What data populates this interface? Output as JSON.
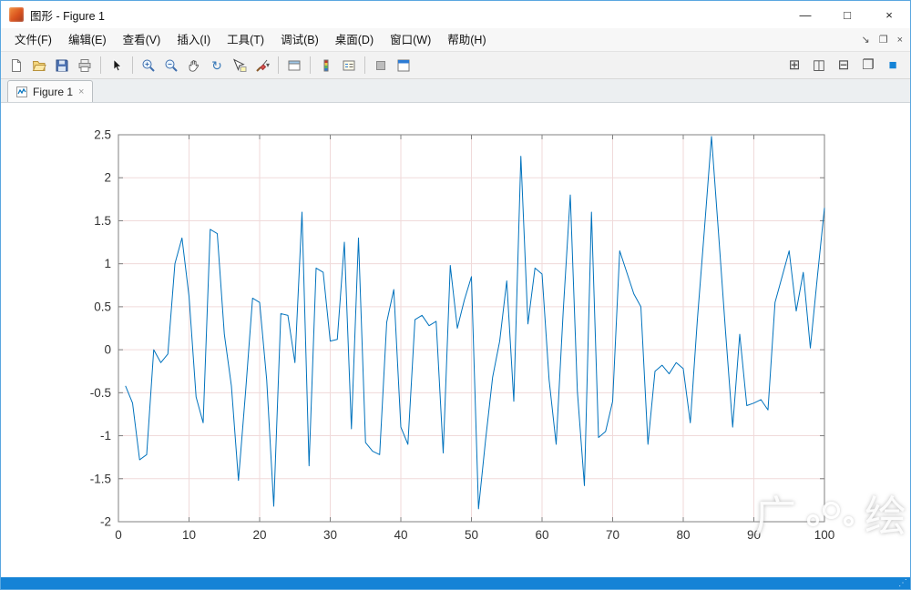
{
  "colors": {
    "accent": "#1583d6",
    "window_border": "#5aa7e0"
  },
  "window": {
    "title": "图形 - Figure 1",
    "controls": {
      "minimize": "—",
      "maximize": "□",
      "close": "×"
    }
  },
  "menubar": {
    "items": [
      "文件(F)",
      "编辑(E)",
      "查看(V)",
      "插入(I)",
      "工具(T)",
      "调试(B)",
      "桌面(D)",
      "窗口(W)",
      "帮助(H)"
    ],
    "right_icons": {
      "dock_arrow": "↘",
      "undock": "❐",
      "close": "×"
    }
  },
  "toolbar": {
    "icons": [
      "new-figure",
      "open-file",
      "save-figure",
      "print-figure",
      "edit-cursor",
      "zoom-in",
      "zoom-out",
      "pan",
      "rotate-3d",
      "data-cursor",
      "brush",
      "link-plots",
      "insert-colorbar",
      "insert-legend",
      "hide-plot-tools",
      "dock-figure"
    ],
    "right_icons": [
      "tile-windows",
      "split-vertical",
      "split-horizontal",
      "float-windows",
      "active-window"
    ],
    "rotate_glyph": "↻",
    "brush_dropdown": "▾",
    "layout_glyphs": {
      "tile": "⊞",
      "split_vertical": "◫",
      "split_horizontal": "⊟",
      "float": "❐",
      "active": "■"
    }
  },
  "tab": {
    "label": "Figure 1",
    "close": "×"
  },
  "chart_data": {
    "type": "line",
    "title": "",
    "xlabel": "",
    "ylabel": "",
    "xlim": [
      0,
      100
    ],
    "ylim": [
      -2,
      2.5
    ],
    "xticks": [
      0,
      10,
      20,
      30,
      40,
      50,
      60,
      70,
      80,
      90,
      100
    ],
    "yticks": [
      -2,
      -1.5,
      -1,
      -0.5,
      0,
      0.5,
      1,
      1.5,
      2,
      2.5
    ],
    "grid": true,
    "legend": false,
    "line_color": "#0072bd",
    "grid_color": "#f0dada",
    "axis_color": "#808080",
    "tick_color": "#333333",
    "x_start": 1,
    "x_step": 1,
    "values": [
      -0.42,
      -0.62,
      -1.28,
      -1.22,
      0.0,
      -0.15,
      -0.05,
      1.0,
      1.3,
      0.62,
      -0.55,
      -0.85,
      1.4,
      1.35,
      0.18,
      -0.42,
      -1.52,
      -0.5,
      0.6,
      0.55,
      -0.35,
      -1.82,
      0.42,
      0.4,
      -0.15,
      1.6,
      -1.35,
      0.95,
      0.9,
      0.1,
      0.12,
      1.25,
      -0.92,
      1.3,
      -1.08,
      -1.18,
      -1.22,
      0.32,
      0.7,
      -0.9,
      -1.1,
      0.35,
      0.4,
      0.28,
      0.33,
      -1.2,
      0.98,
      0.25,
      0.58,
      0.85,
      -1.85,
      -1.05,
      -0.32,
      0.1,
      0.8,
      -0.6,
      2.25,
      0.3,
      0.95,
      0.88,
      -0.35,
      -1.1,
      0.45,
      1.8,
      -0.48,
      -1.58,
      1.6,
      -1.02,
      -0.95,
      -0.6,
      1.15,
      0.9,
      0.65,
      0.5,
      -1.1,
      -0.25,
      -0.18,
      -0.28,
      -0.15,
      -0.22,
      -0.85,
      0.35,
      1.4,
      2.48,
      1.35,
      0.2,
      -0.9,
      0.18,
      -0.65,
      -0.62,
      -0.58,
      -0.7,
      0.55,
      0.85,
      1.15,
      0.45,
      0.9,
      0.02,
      0.85,
      1.65
    ]
  },
  "watermark": {
    "left": "广",
    "right": "绘"
  },
  "statusbar": {
    "grip": "⋰"
  }
}
